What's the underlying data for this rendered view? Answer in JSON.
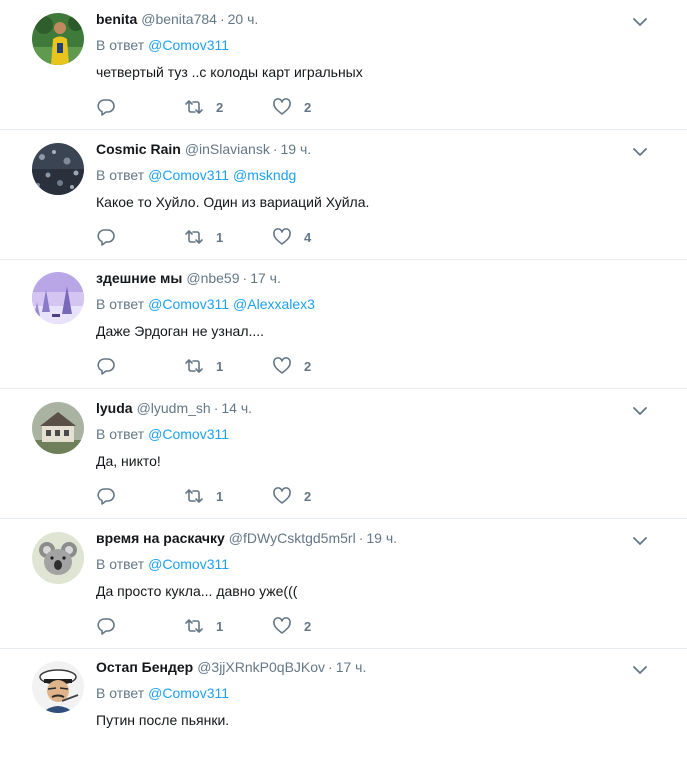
{
  "tweets": [
    {
      "name": "benita",
      "handle": "@benita784",
      "time": "20 ч.",
      "reply_prefix": "В ответ",
      "mentions": [
        "@Comov311"
      ],
      "text": "четвертый туз ..с колоды карт игральных",
      "retweets": "2",
      "likes": "2",
      "avatar": "person-in-yellow-on-green-avatar"
    },
    {
      "name": "Cosmic Rain",
      "handle": "@inSlaviansk",
      "time": "19 ч.",
      "reply_prefix": "В ответ",
      "mentions": [
        "@Comov311",
        "@mskndg"
      ],
      "text": "Какое то Хуйло. Один из вариаций Хуйла.",
      "retweets": "1",
      "likes": "4",
      "avatar": "rain-drops-avatar"
    },
    {
      "name": "здешние мы",
      "handle": "@nbe59",
      "time": "17 ч.",
      "reply_prefix": "В ответ",
      "mentions": [
        "@Comov311",
        "@Alexxalex3"
      ],
      "text": "Даже Эрдоган не узнал....",
      "retweets": "1",
      "likes": "2",
      "avatar": "purple-winter-landscape-avatar"
    },
    {
      "name": "lyuda",
      "handle": "@lyudm_sh",
      "time": "14 ч.",
      "reply_prefix": "В ответ",
      "mentions": [
        "@Comov311"
      ],
      "text": "Да, никто!",
      "retweets": "1",
      "likes": "2",
      "avatar": "old-house-avatar"
    },
    {
      "name": "время на раскачку",
      "handle": "@fDWyCsktgd5m5rl",
      "time": "19 ч.",
      "reply_prefix": "В ответ",
      "mentions": [
        "@Comov311"
      ],
      "text": "Да просто кукла... давно уже(((",
      "retweets": "1",
      "likes": "2",
      "avatar": "koala-avatar"
    },
    {
      "name": "Остап Бендер",
      "handle": "@3jjXRnkP0qBJKov",
      "time": "17 ч.",
      "reply_prefix": "В ответ",
      "mentions": [
        "@Comov311"
      ],
      "text": "Путин после пьянки.",
      "retweets": "",
      "likes": "",
      "avatar": "captain-cap-man-avatar"
    }
  ],
  "colors": {
    "link": "#1da1f2",
    "muted": "#657786",
    "text": "#14171a",
    "divider": "#e6ecf0"
  },
  "icons": {
    "reply": "reply-icon",
    "retweet": "retweet-icon",
    "like": "heart-icon",
    "menu": "chevron-down-icon"
  }
}
